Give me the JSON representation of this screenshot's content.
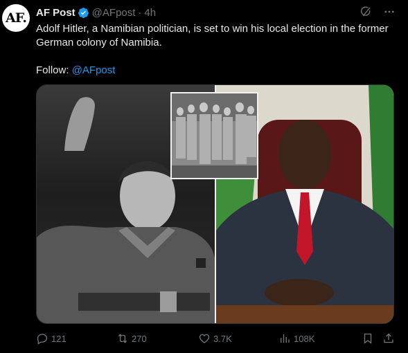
{
  "post": {
    "avatar_text": "AF.",
    "author_name": "AF Post",
    "handle": "@AFpost",
    "separator": "·",
    "time": "4h",
    "text_line": "Adolf Hitler, a Namibian politician, is set to win his local election in the former German colony of Namibia.",
    "follow_label": "Follow: ",
    "follow_link": "@AFpost"
  },
  "actions": {
    "replies": "121",
    "reposts": "270",
    "likes": "3.7K",
    "views": "108K"
  },
  "icons": {
    "verified": "verified-badge-icon",
    "grok": "grok-icon",
    "more": "more-icon",
    "reply": "reply-icon",
    "repost": "repost-icon",
    "like": "like-icon",
    "views": "views-icon",
    "bookmark": "bookmark-icon",
    "share": "share-icon"
  },
  "colors": {
    "background": "#000000",
    "text": "#e7e9ea",
    "muted": "#71767b",
    "link": "#1d9bf0",
    "verified": "#1d9bf0"
  }
}
